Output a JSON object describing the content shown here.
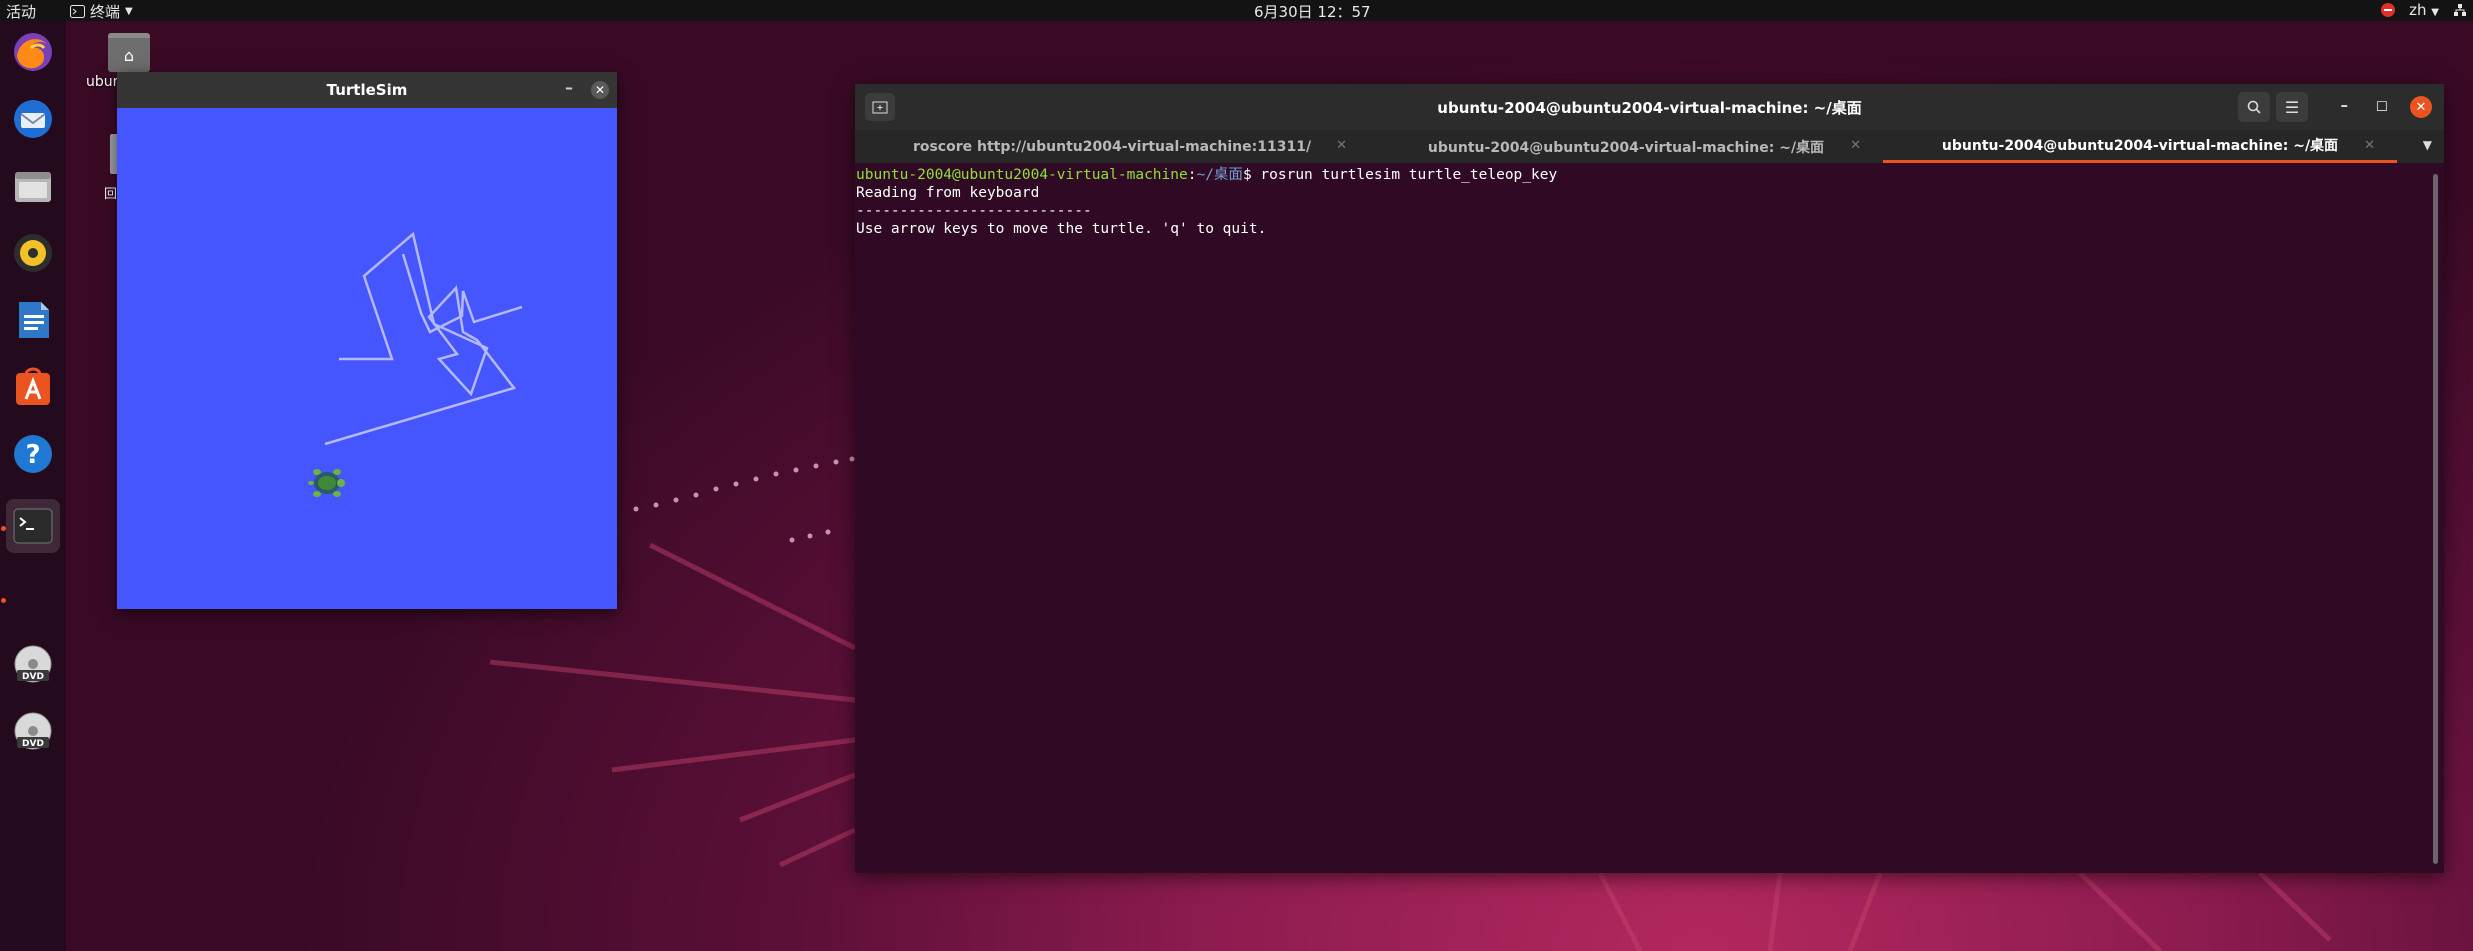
{
  "topbar": {
    "activities": "活动",
    "app_menu_label": "终端",
    "clock": "6月30日 12：57",
    "input_method": "zh"
  },
  "desktop": {
    "home_label": "ubun",
    "trash_label": "回"
  },
  "dock": {
    "items": [
      {
        "name": "firefox",
        "icon": "firefox-icon"
      },
      {
        "name": "thunderbird",
        "icon": "thunderbird-icon"
      },
      {
        "name": "files",
        "icon": "files-icon"
      },
      {
        "name": "rhythmbox",
        "icon": "rhythmbox-icon"
      },
      {
        "name": "writer",
        "icon": "libreoffice-writer-icon"
      },
      {
        "name": "software",
        "icon": "ubuntu-software-icon"
      },
      {
        "name": "help",
        "icon": "help-icon"
      },
      {
        "name": "terminal",
        "icon": "terminal-icon"
      },
      {
        "name": "dvd-1",
        "icon": "dvd-icon",
        "label": "DVD"
      },
      {
        "name": "dvd-2",
        "icon": "dvd-icon",
        "label": "DVD"
      }
    ]
  },
  "turtlesim": {
    "title": "TurtleSim",
    "background_color": "#4556ff",
    "pen_color": "#b3b8ff"
  },
  "terminal": {
    "title": "ubuntu-2004@ubuntu2004-virtual-machine: ~/桌面",
    "tabs": [
      {
        "label": "roscore http://ubuntu2004-virtual-machine:11311/",
        "active": false
      },
      {
        "label": "ubuntu-2004@ubuntu2004-virtual-machine: ~/桌面",
        "active": false
      },
      {
        "label": "ubuntu-2004@ubuntu2004-virtual-machine: ~/桌面",
        "active": true
      }
    ],
    "prompt_user": "ubuntu-2004@ubuntu2004-virtual-machine",
    "prompt_sep": ":",
    "prompt_path": "~/桌面",
    "command": "$ rosrun turtlesim turtle_teleop_key",
    "output": [
      "Reading from keyboard",
      "---------------------------",
      "Use arrow keys to move the turtle. 'q' to quit."
    ]
  },
  "colors": {
    "accent": "#e95420",
    "terminal_bg": "#300a24",
    "prompt_user": "#8ae234",
    "prompt_path": "#729fcf"
  }
}
